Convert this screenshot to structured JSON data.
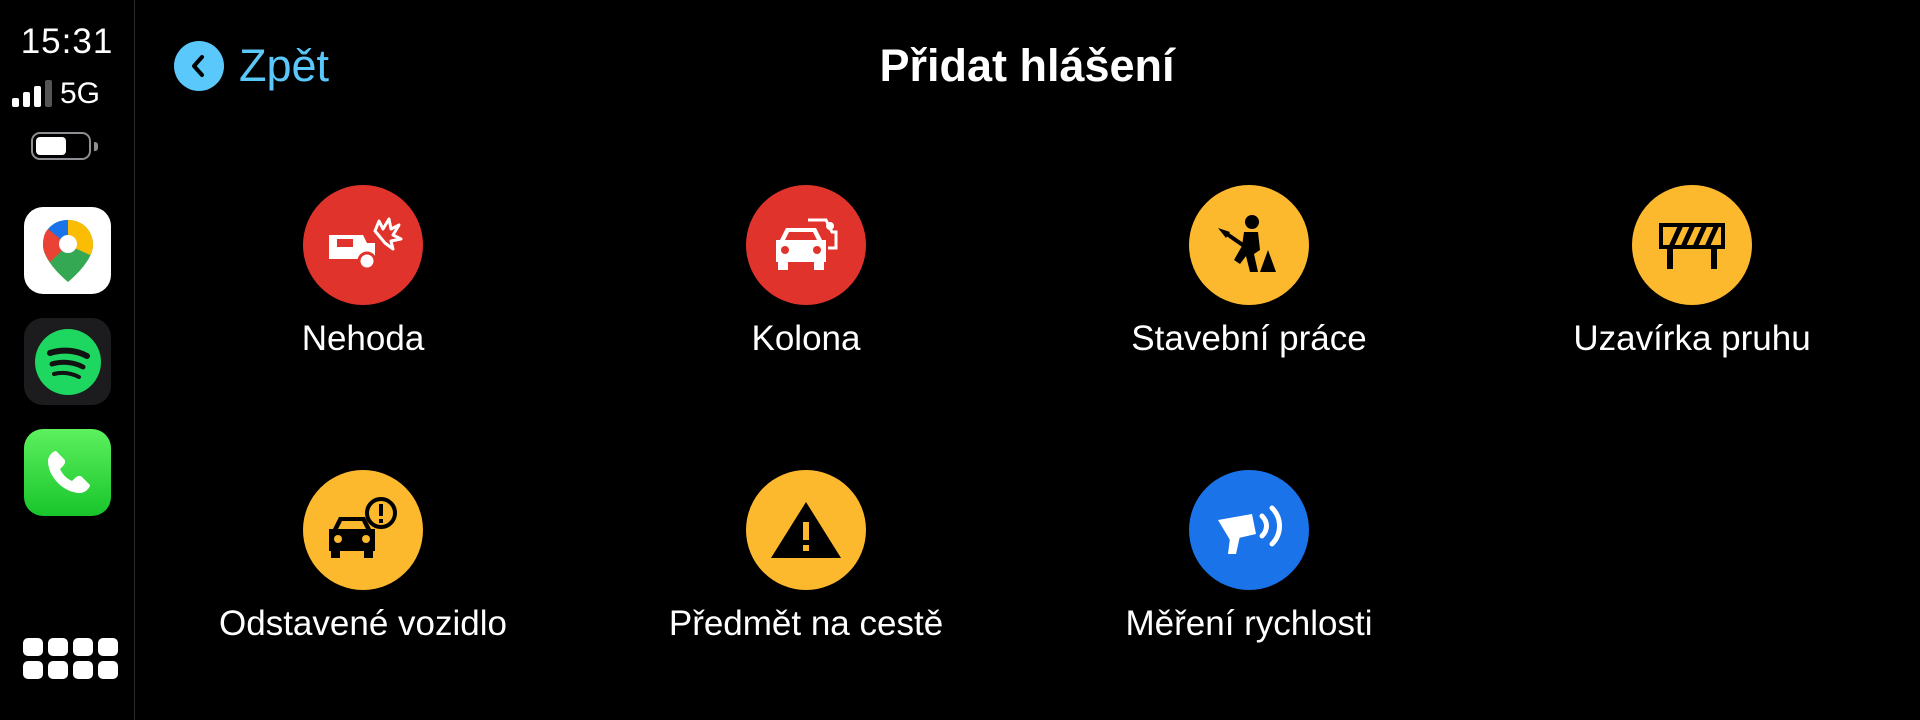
{
  "status": {
    "time": "15:31",
    "network": "5G",
    "signal_bars": 3,
    "battery_level": 0.55
  },
  "sidebar": {
    "apps": [
      {
        "name": "Google Maps",
        "icon": "google-maps-icon"
      },
      {
        "name": "Spotify",
        "icon": "spotify-icon"
      },
      {
        "name": "Phone",
        "icon": "phone-icon"
      }
    ],
    "app_grid_icon": "app-grid-icon"
  },
  "header": {
    "back_label": "Zpět",
    "title": "Přidat hlášení"
  },
  "colors": {
    "red": "#e0332c",
    "yellow": "#fdb92e",
    "blue": "#1a73e8",
    "back_blue": "#5ac8fa"
  },
  "reports": [
    {
      "label": "Nehoda",
      "icon": "car-crash-icon",
      "color": "red"
    },
    {
      "label": "Kolona",
      "icon": "traffic-jam-icon",
      "color": "red"
    },
    {
      "label": "Stavební práce",
      "icon": "road-work-icon",
      "color": "yellow"
    },
    {
      "label": "Uzavírka pruhu",
      "icon": "lane-closure-icon",
      "color": "yellow"
    },
    {
      "label": "Odstavené vozidlo",
      "icon": "stalled-vehicle-icon",
      "color": "yellow"
    },
    {
      "label": "Předmět na cestě",
      "icon": "warning-triangle-icon",
      "color": "yellow"
    },
    {
      "label": "Měření rychlosti",
      "icon": "speed-camera-icon",
      "color": "blue"
    }
  ]
}
